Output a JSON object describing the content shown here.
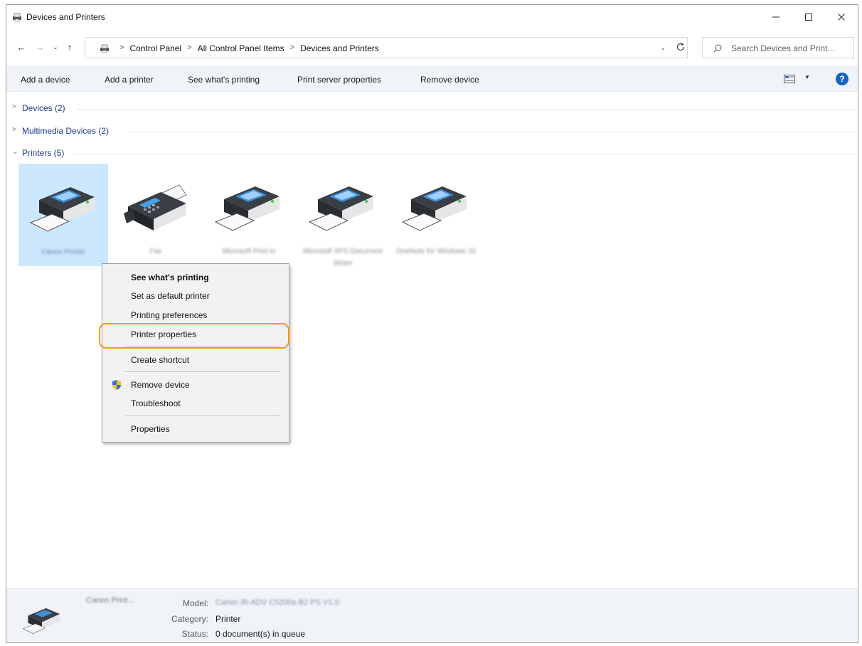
{
  "window": {
    "title": "Devices and Printers",
    "controls": {
      "minimize": "—",
      "maximize": "☐",
      "close": "✕"
    }
  },
  "address": {
    "crumbs": [
      "Control Panel",
      "All Control Panel Items",
      "Devices and Printers"
    ],
    "search_placeholder": "Search Devices and Print..."
  },
  "commands": [
    "Add a device",
    "Add a printer",
    "See what's printing",
    "Print server properties",
    "Remove device"
  ],
  "groups": [
    {
      "title": "Devices (2)",
      "expanded": false
    },
    {
      "title": "Multimedia Devices (2)",
      "expanded": false
    },
    {
      "title": "Printers (5)",
      "expanded": true
    }
  ],
  "printers": [
    {
      "label": "Canon Printer",
      "icon": "printer-icon",
      "selected": true
    },
    {
      "label": "Fax",
      "icon": "fax-icon",
      "selected": false
    },
    {
      "label": "Microsoft Print to",
      "icon": "printer-icon",
      "selected": false
    },
    {
      "label": "Microsoft XPS Document Writer",
      "icon": "printer-icon",
      "selected": false
    },
    {
      "label": "OneNote for Windows 10",
      "icon": "printer-icon",
      "selected": false
    }
  ],
  "context_menu": {
    "items": [
      {
        "label": "See what's printing",
        "bold": true
      },
      {
        "label": "Set as default printer"
      },
      {
        "label": "Printing preferences"
      },
      {
        "label": "Printer properties",
        "highlighted": true
      },
      {
        "label": "Create shortcut"
      },
      {
        "label": "Remove device",
        "icon": "shield-icon"
      },
      {
        "label": "Troubleshoot"
      },
      {
        "label": "Properties"
      }
    ],
    "highlight_color": "#f29a18"
  },
  "details": {
    "name": "Canon Print...",
    "model_key": "Model:",
    "model_value": "Canon iR-ADV C5200s-B2 PS V1.0",
    "category_key": "Category:",
    "category_value": "Printer",
    "status_key": "Status:",
    "status_value": "0 document(s) in queue"
  },
  "colors": {
    "accent": "#0078d7",
    "selection": "#cce8ff",
    "help": "#1565c0"
  }
}
